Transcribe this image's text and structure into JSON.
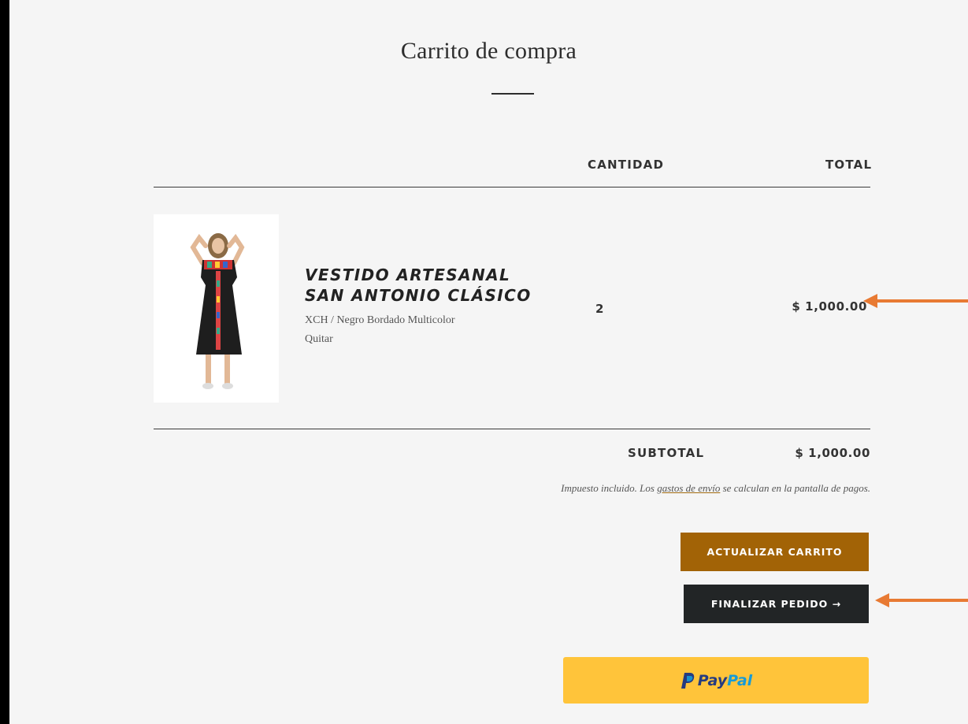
{
  "cart": {
    "title": "Carrito de compra",
    "columns": {
      "quantity": "CANTIDAD",
      "total": "TOTAL"
    },
    "items": [
      {
        "name": "VESTIDO ARTESANAL SAN ANTONIO CLÁSICO",
        "variant": "XCH / Negro Bordado Multicolor",
        "remove_label": "Quitar",
        "quantity": "2",
        "total": "$ 1,000.00"
      }
    ],
    "subtotal_label": "SUBTOTAL",
    "subtotal_value": "$ 1,000.00",
    "note_before": "Impuesto incluido. Los ",
    "note_link": "gastos de envío",
    "note_after": " se calculan en la pantalla de pagos.",
    "update_button": "ACTUALIZAR CARRITO",
    "checkout_button": "FINALIZAR PEDIDO →",
    "paypal": {
      "pay": "Pay",
      "pal": "Pal"
    }
  },
  "colors": {
    "accent": "#a26306",
    "dark_button": "#222526",
    "paypal_yellow": "#ffc43a",
    "annotation_arrow": "#e87a33"
  },
  "icons": [
    "paypal-logo-icon",
    "annotation-arrow-icon"
  ]
}
